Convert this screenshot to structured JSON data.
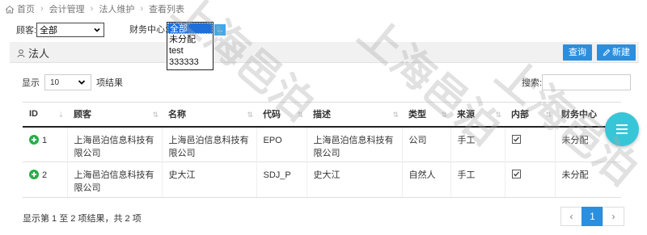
{
  "breadcrumb": [
    "首页",
    "会计管理",
    "法人维护",
    "查看列表"
  ],
  "filters": {
    "customer_label": "顾客:",
    "customer_value": "全部",
    "finance_label": "财务中心:",
    "finance_options": [
      "全部",
      "未分配",
      "test",
      "333333"
    ],
    "finance_selected": "全部",
    "finance_button": "..."
  },
  "panel": {
    "title": "法人",
    "query_button": "查询",
    "new_button": "新建"
  },
  "length_menu": {
    "prefix": "显示",
    "value": "10",
    "suffix": "项结果"
  },
  "search": {
    "label": "搜索:"
  },
  "table": {
    "columns": [
      "ID",
      "顾客",
      "名称",
      "代码",
      "描述",
      "类型",
      "来源",
      "内部",
      "财务中心"
    ],
    "rows": [
      {
        "id": "1",
        "customer": "上海邑泊信息科技有限公司",
        "name": "上海邑泊信息科技有限公司",
        "code": "EPO",
        "description": "上海邑泊信息科技有限公司",
        "type": "公司",
        "source": "手工",
        "internal": true,
        "finance_center": "未分配"
      },
      {
        "id": "2",
        "customer": "上海邑泊信息科技有限公司",
        "name": "史大江",
        "code": "SDJ_P",
        "description": "史大江",
        "type": "自然人",
        "source": "手工",
        "internal": true,
        "finance_center": "未分配"
      }
    ]
  },
  "footer": {
    "info": "显示第 1 至 2 项结果，共 2 项",
    "prev": "‹",
    "page": "1",
    "next": "›"
  },
  "watermark_text": "上海邑泊",
  "colors": {
    "primary": "#2b8fe0",
    "fab": "#37c6d8",
    "success": "#2eaa4a"
  },
  "icons": {
    "home": "home-icon",
    "user": "user-icon",
    "pencil": "pencil-icon",
    "expand": "plus-circle-icon",
    "fab": "menu-icon"
  }
}
